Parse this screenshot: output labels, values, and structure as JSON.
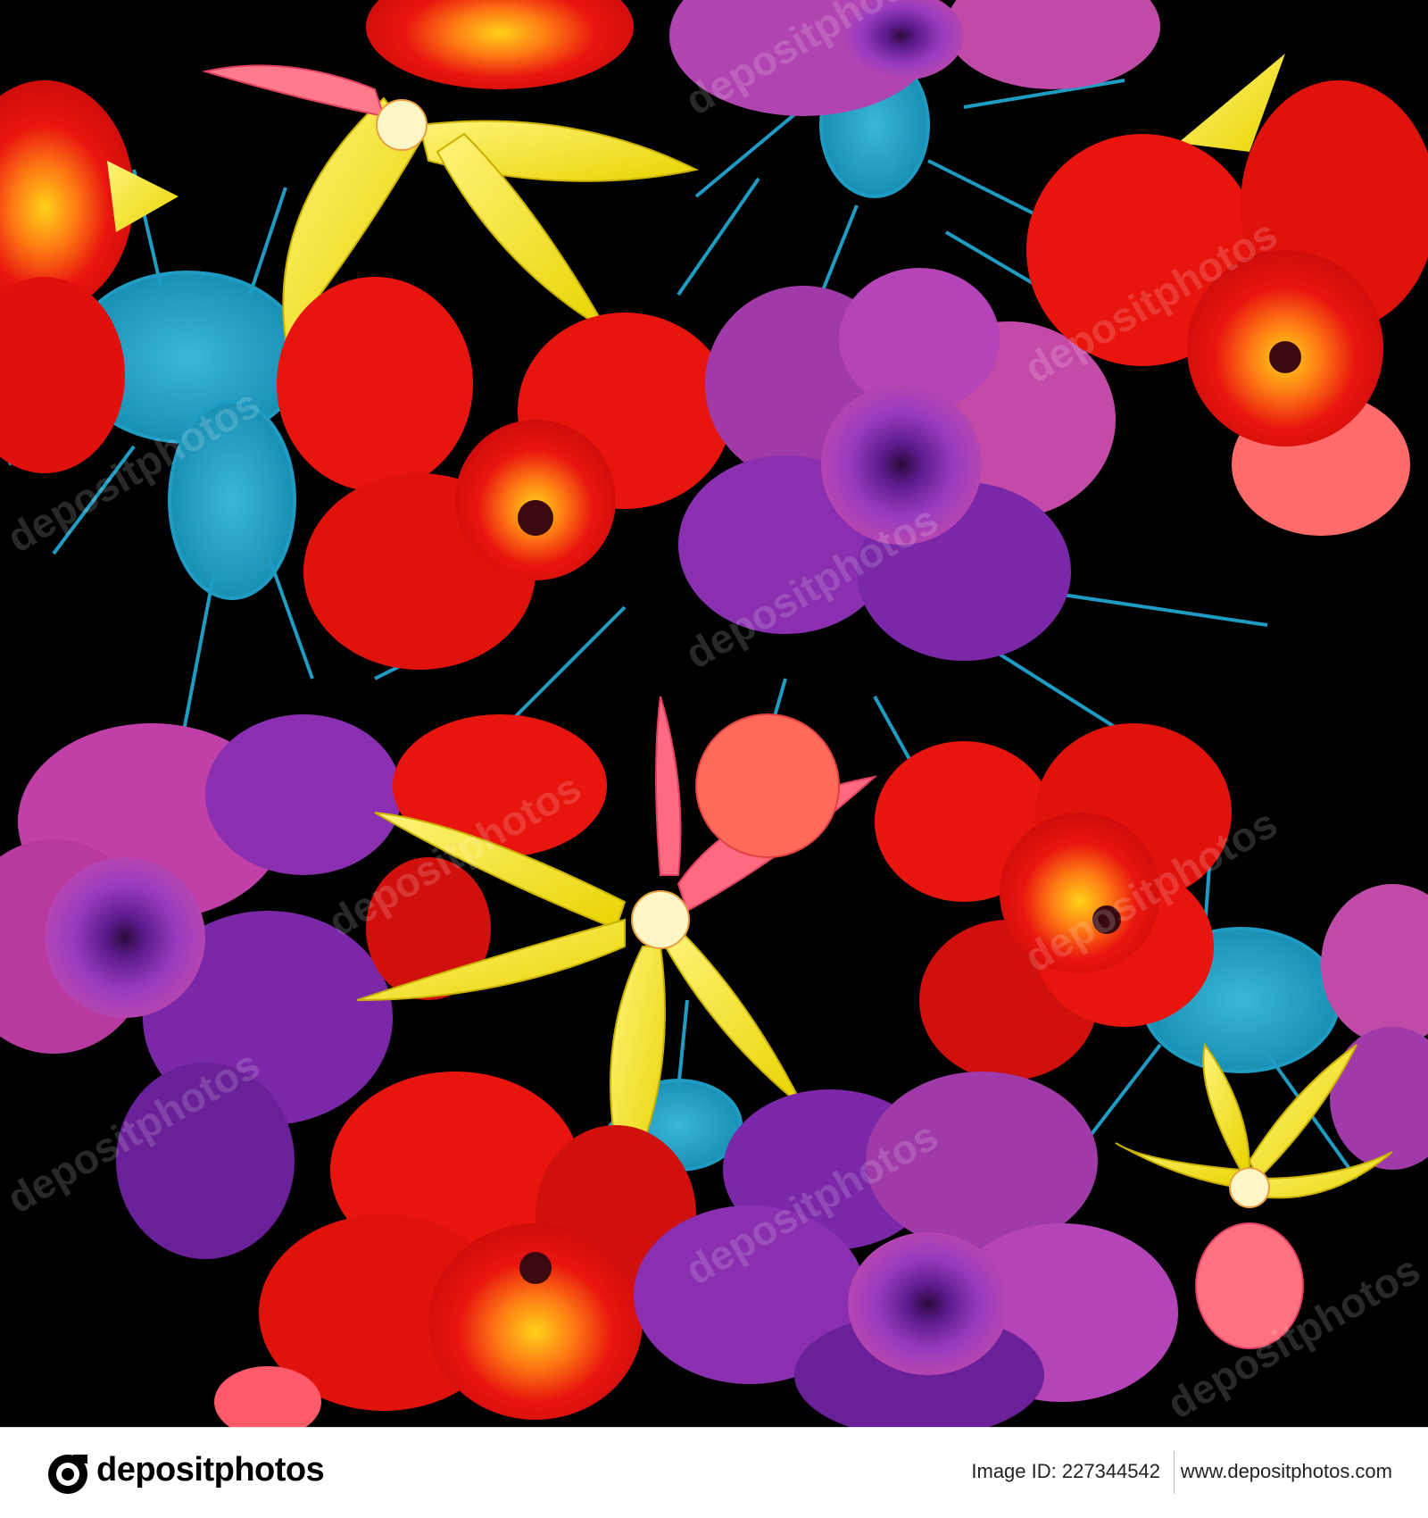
{
  "image": {
    "description_colors": {
      "background": "#000000",
      "splash": "#1fa3c6",
      "red_petal": "#e8130f",
      "yellow_petal": "#f4e714",
      "purple_petal": "#8a2fb0",
      "magenta_petal": "#c43fa8"
    }
  },
  "watermark": {
    "text": "depositphotos"
  },
  "footer": {
    "brand": "depositphotos",
    "image_id_label": "Image ID:",
    "image_id": "227344542",
    "url": "www.depositphotos.com"
  }
}
